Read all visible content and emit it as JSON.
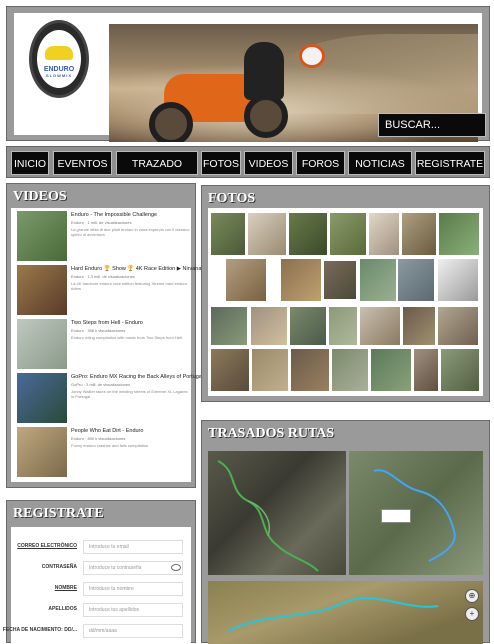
{
  "header": {
    "logo_text": "ENDURO",
    "logo_subtext": "SLOWMIX",
    "search_label": "BUSCAR..."
  },
  "nav": {
    "items": [
      "INICIO",
      "EVENTOS",
      "TRAZADO RUTAS",
      "FOTOS",
      "VIDEOS",
      "FOROS",
      "NOTICIAS",
      "REGISTRATE"
    ]
  },
  "videos": {
    "title": "VIDEOS",
    "items": [
      {
        "title": "Enduro - The Impossible Challenge",
        "meta": "Enduro  ·  1 mill. de visualizaciones",
        "desc": "La grande sfida di due piloti enduro in zona impervia con il classico spirito di avventura",
        "thumb_color": "#6a8a5a"
      },
      {
        "title": "Hard Enduro 🏆 Show 🏆 4K Race Edition ▶ Nirvana Xtreme 2016 ▶ 4K",
        "meta": "Enduro  ·  1,3 mill. de visualizaciones",
        "desc": "La 4K hardcore enduro race edition featuring Xtreme hard enduro riders",
        "thumb_color": "#8a6a4a"
      },
      {
        "title": "Two Steps from Hell - Enduro",
        "meta": "Enduro  ·  396 k visualizaciones",
        "desc": "Enduro riding compilation with music from Two Steps from Hell",
        "thumb_color": "#aab0a8"
      },
      {
        "title": "GoPro: Enduro MX Racing the Back Alleys of Portugal with Jonny Walker Extreme XL Lagares",
        "meta": "GoPro  ·  3 mill. de visualizaciones",
        "desc": "Jonny Walker takes on the winding streets of Extreme XL Lagares in Portugal",
        "thumb_color": "#5a6a8a"
      },
      {
        "title": "People Who Eat Dirt - Enduro",
        "meta": "Enduro  ·  890 k visualizaciones",
        "desc": "Funny enduro crashes and fails compilation",
        "thumb_color": "#b09a70"
      }
    ]
  },
  "photos": {
    "title": "FOTOS",
    "colors": [
      "#7a8a5a",
      "#a89a80",
      "#6a7a4a",
      "#8a9a6a",
      "#c0b8a8",
      "#9a8a70",
      "#5a7a4a",
      "#b0a080",
      "#e8e8e8",
      "#7a6a5a",
      "#8a7a60",
      "#6a8a6a",
      "#aab0b0",
      "#9a7a5a",
      "#5a6a5a",
      "#7a8a6a",
      "#a09080",
      "#8a9a7a",
      "#c8c0b0",
      "#6a5a4a",
      "#b0a890"
    ]
  },
  "routes": {
    "title": "TRASADOS RUTAS"
  },
  "register": {
    "title": "REGISTRATE",
    "fields": [
      {
        "label": "CORREO ELECTRÓNICO",
        "placeholder": "Introduce tu email"
      },
      {
        "label": "CONTRASEÑA",
        "placeholder": "Introduce tu contraseña"
      },
      {
        "label": "NOMBRE",
        "placeholder": "Introduce tu nombre"
      },
      {
        "label": "APELLIDOS",
        "placeholder": "Introduce tus apellidos"
      },
      {
        "label": "FECHA DE NACIMIENTO: DD/...",
        "placeholder": "dd/mm/aaaa"
      }
    ]
  }
}
